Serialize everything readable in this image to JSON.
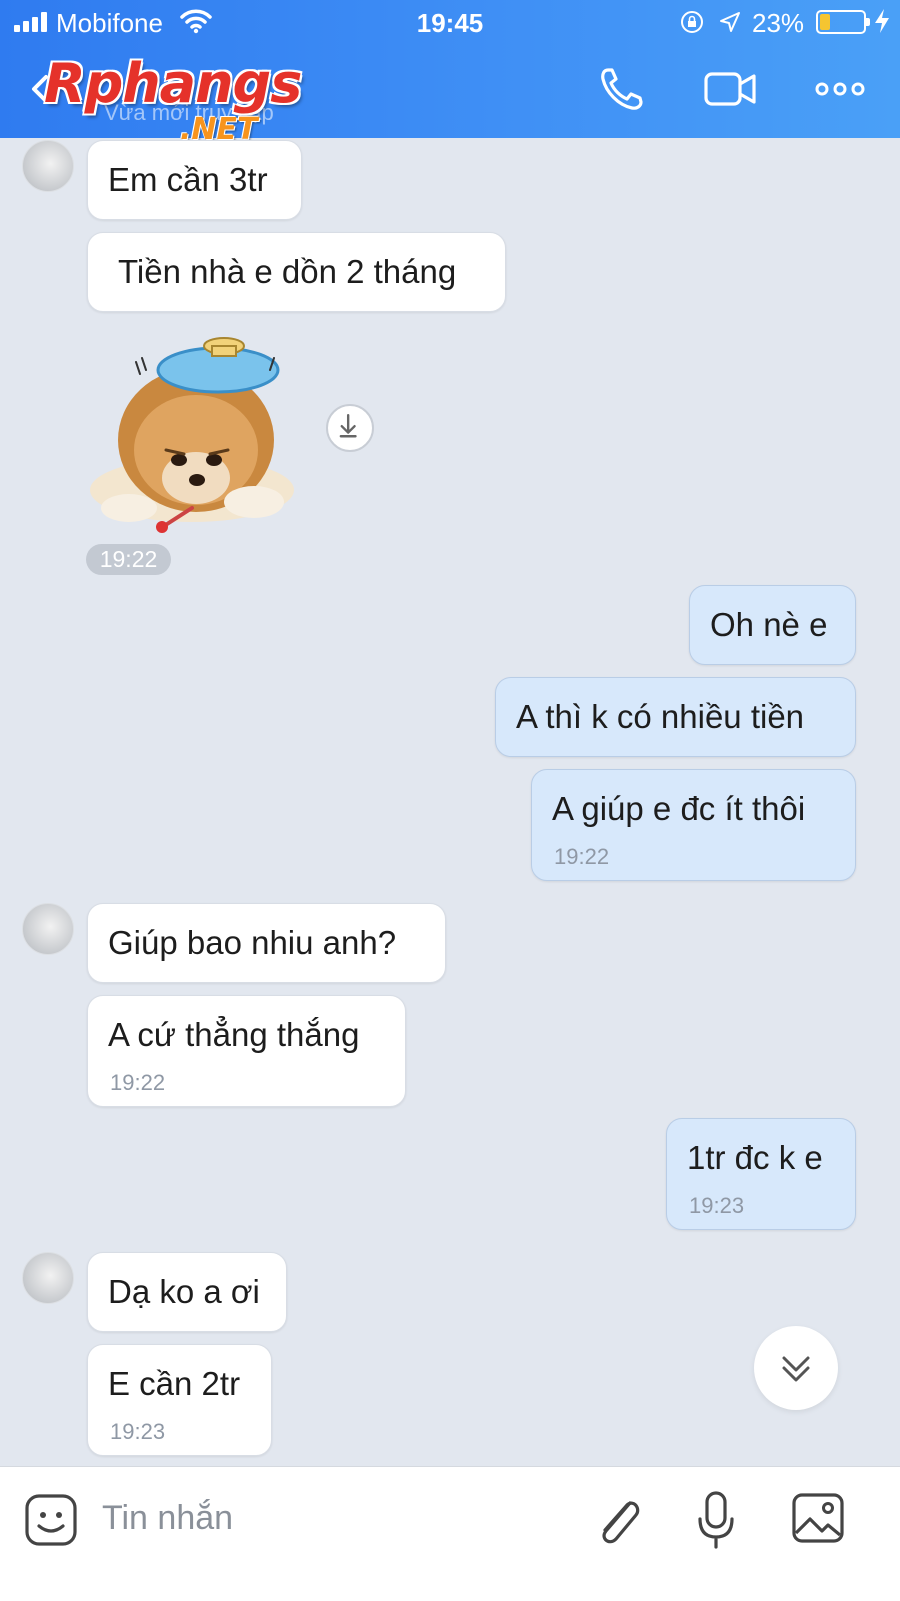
{
  "status_bar": {
    "carrier": "Mobifone",
    "time": "19:45",
    "battery_percent": "23%",
    "battery_level": 0.23
  },
  "header": {
    "logo_main": "Rphangs",
    "logo_sub": ".NET",
    "subtitle": "Vừa mới truy cập"
  },
  "messages": [
    {
      "side": "in",
      "text": "Em cần 3tr"
    },
    {
      "side": "in",
      "text": "Tiền nhà e dồn 2 tháng"
    },
    {
      "side": "in",
      "type": "sticker",
      "time": "19:22"
    },
    {
      "side": "out",
      "text": "Oh nè e"
    },
    {
      "side": "out",
      "text": "A thì k có nhiều tiền"
    },
    {
      "side": "out",
      "text": "A giúp e đc ít thôi",
      "time": "19:22"
    },
    {
      "side": "in",
      "text": "Giúp bao nhiu anh?"
    },
    {
      "side": "in",
      "text": "A cứ thẳng thắng",
      "time": "19:22"
    },
    {
      "side": "out",
      "text": "1tr đc k e",
      "time": "19:23"
    },
    {
      "side": "in",
      "text": "Dạ ko a ơi"
    },
    {
      "side": "in",
      "text": "E cần 2tr",
      "time": "19:23"
    }
  ],
  "input_bar": {
    "placeholder": "Tin nhắn"
  },
  "icons": [
    "signal-icon",
    "wifi-icon",
    "lock-rotation-icon",
    "location-icon",
    "battery-icon",
    "charging-icon",
    "back-icon",
    "phone-icon",
    "video-call-icon",
    "more-icon",
    "download-icon",
    "scroll-down-icon",
    "emoji-icon",
    "attach-icon",
    "microphone-icon",
    "image-icon"
  ],
  "colors": {
    "header": "#3a8af3",
    "chat_background": "#e2e7ef",
    "incoming_bubble": "#ffffff",
    "outgoing_bubble": "#d7e8fb",
    "logo_red": "#e5322a",
    "logo_orange": "#f7941d"
  }
}
